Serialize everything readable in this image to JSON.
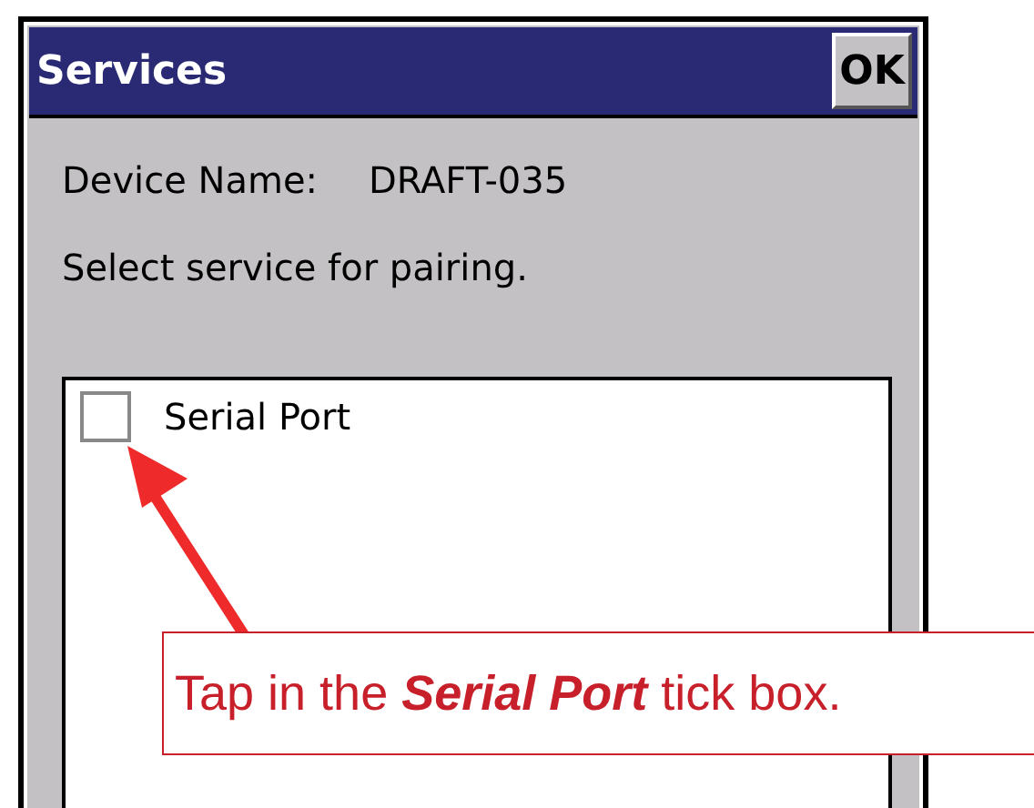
{
  "window": {
    "title": "Services",
    "ok_button": "OK"
  },
  "device_name": {
    "label": "Device Name:",
    "value": "DRAFT-035"
  },
  "instruction": "Select service for pairing.",
  "services": [
    {
      "label": "Serial Port",
      "checked": false
    }
  ],
  "callout": {
    "text": "Tap in the **Serial Port** tick box."
  }
}
